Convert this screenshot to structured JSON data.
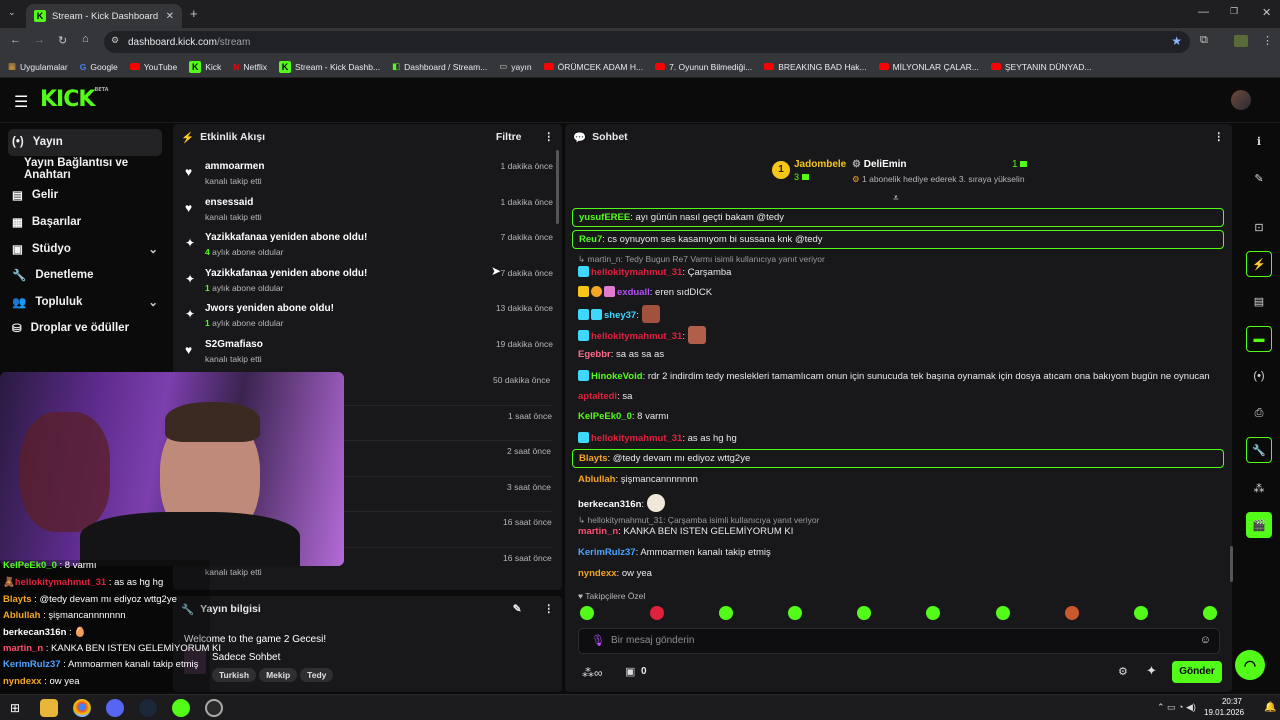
{
  "browser": {
    "tab_title": "Stream - Kick Dashboard",
    "url_host": "dashboard.kick.com",
    "url_path": "/stream",
    "bookmarks": [
      "Uygulamalar",
      "Google",
      "YouTube",
      "Kick",
      "Netflix",
      "Stream - Kick Dashb...",
      "Dashboard / Stream...",
      "yayın",
      "ÖRÜMCEK ADAM H...",
      "7. Oyunun Bilmediği...",
      "BREAKING BAD Hak...",
      "MİLYONLAR ÇALAR...",
      "ŞEYTANIN DÜNYAD..."
    ]
  },
  "site": {
    "logo": "KICK",
    "logo_beta": "BETA"
  },
  "sidebar": {
    "items": [
      {
        "label": "Yayın",
        "icon": "broadcast-icon"
      },
      {
        "label": "Yayın Bağlantısı ve Anahtarı",
        "icon": ""
      },
      {
        "label": "Gelir",
        "icon": "revenue-icon"
      },
      {
        "label": "Başarılar",
        "icon": "achievements-icon"
      },
      {
        "label": "Stüdyo",
        "icon": "studio-icon"
      },
      {
        "label": "Denetleme",
        "icon": "wrench-icon"
      },
      {
        "label": "Topluluk",
        "icon": "community-icon"
      },
      {
        "label": "Droplar ve ödüller",
        "icon": "drops-icon"
      }
    ]
  },
  "feed": {
    "title": "Etkinlik Akışı",
    "filter_label": "Filtre",
    "items": [
      {
        "title": "ammoarmen",
        "sub_count": "",
        "sub": "kanalı takip etti",
        "time": "1 dakika önce",
        "icon": "heart-icon"
      },
      {
        "title": "ensessaid",
        "sub_count": "",
        "sub": "kanalı takip etti",
        "time": "1 dakika önce",
        "icon": "heart-icon"
      },
      {
        "title": "Yazikkafanaa yeniden abone oldu!",
        "sub_count": "4",
        "sub": "aylık abone oldular",
        "time": "7 dakika önce",
        "icon": "sparkle-icon"
      },
      {
        "title": "Yazikkafanaa yeniden abone oldu!",
        "sub_count": "1",
        "sub": "aylık abone oldular",
        "time": "7 dakika önce",
        "icon": "sparkle-icon"
      },
      {
        "title": "Jwors yeniden abone oldu!",
        "sub_count": "1",
        "sub": "aylık abone oldular",
        "time": "13 dakika önce",
        "icon": "sparkle-icon"
      },
      {
        "title": "S2Gmafiaso",
        "sub_count": "",
        "sub": "kanalı takip etti",
        "time": "19 dakika önce",
        "icon": "heart-icon"
      }
    ],
    "more_times": [
      "50 dakika önce",
      "1 saat önce",
      "2 saat önce",
      "3 saat önce",
      "16 saat önce",
      "16 saat önce"
    ],
    "last_sub": "kanalı takip etti"
  },
  "stream_info": {
    "title": "Yayın bilgisi",
    "stream_title": "Welcome to the game 2 Gecesi!",
    "category": "Sadece Sohbet",
    "tags": [
      "Turkish",
      "Mekip",
      "Tedy"
    ]
  },
  "chat": {
    "title": "Sohbet",
    "top_gifter_rank": "1",
    "top_gifter_name": "Jadombele",
    "top_gifter_count": "3",
    "gift_user": "DeliEmin",
    "gift_count": "1",
    "gift_text": "1 abonelik hediye ederek 3. sıraya yükselin",
    "messages": [
      {
        "user": "yusufEREE",
        "text": "ayı günün nasıl geçti bakam @tedy",
        "color": "#53fc18"
      },
      {
        "user": "Reu7",
        "text": "cs oynuyom ses kasamıyom bi sussana knk @tedy",
        "color": "#53fc18"
      },
      {
        "reply": "martin_n: Tedy Bugun Re7 Varmı isimli kullanıcıya yanıt veriyor"
      },
      {
        "user": "hellokitymahmut_31",
        "text": "Çarşamba",
        "color": "#e0213c"
      },
      {
        "user": "exduall",
        "text": "eren sıdDICK",
        "color": "#b84dff"
      },
      {
        "user": "shey37",
        "text": "",
        "color": "#3dd7ff"
      },
      {
        "user": "hellokitymahmut_31",
        "text": "",
        "color": "#e0213c"
      },
      {
        "user": "Egebbr",
        "text": "sa as sa as",
        "color": "#ff6b8a"
      },
      {
        "user": "HinokeVoid",
        "text": "rdr 2 indirdim tedy meslekleri tamamlıcam onun için sunucuda tek başına oynamak için dosya atıcam ona bakıyom bugün ne oynucan",
        "color": "#53fc18"
      },
      {
        "user": "aptaltedi",
        "text": "sa",
        "color": "#e0213c"
      },
      {
        "user": "KelPeEk0_0",
        "text": "8 varmı",
        "color": "#53fc18"
      },
      {
        "user": "hellokitymahmut_31",
        "text": "as as hg hg",
        "color": "#e0213c"
      },
      {
        "user": "Blayts",
        "text": "@tedy devam mı ediyoz wttg2ye",
        "color": "#f5a623"
      },
      {
        "user": "Ablullah",
        "text": "şişmancannnnnnn",
        "color": "#f5a623"
      },
      {
        "user": "berkecan316n",
        "text": "",
        "color": "#ffffff"
      },
      {
        "reply": "hellokitymahmut_31: Çarşamba isimli kullanıcıya yanıt veriyor"
      },
      {
        "user": "martin_n",
        "text": "KANKA BEN ISTEN GELEMİYORUM KI",
        "color": "#ff4d6d"
      },
      {
        "user": "KerimRulz37",
        "text": "Ammoarmen kanalı takip etmiş",
        "color": "#4da3ff"
      },
      {
        "user": "nyndexx",
        "text": "ow yea",
        "color": "#f5a623"
      }
    ],
    "followers_only": "Takipçilere Özel",
    "input_placeholder": "Bir mesaj gönderin",
    "points": "0",
    "send_label": "Gönder"
  },
  "overlay": {
    "lines": [
      {
        "user": "KelPeEk0_0",
        "text": "8 varmı",
        "color": "#53fc18"
      },
      {
        "user": "hellokitymahmut_31",
        "text": "as as hg hg",
        "color": "#e0213c"
      },
      {
        "user": "Blayts",
        "text": "@tedy devam mı ediyoz wttg2ye",
        "color": "#f5a623"
      },
      {
        "user": "Ablullah",
        "text": "şişmancannnnnnn",
        "color": "#f5a623"
      },
      {
        "user": "berkecan316n",
        "text": "",
        "color": "#ffffff"
      },
      {
        "user": "martin_n",
        "text": "KANKA BEN ISTEN GELEMİYORUM KI",
        "color": "#ff4d6d"
      },
      {
        "user": "KerimRulz37",
        "text": "Ammoarmen kanalı takip etmiş",
        "color": "#4da3ff"
      },
      {
        "user": "nyndexx",
        "text": "ow yea",
        "color": "#f5a623"
      }
    ]
  },
  "taskbar": {
    "time": "20:37",
    "date": "19.01.2026"
  },
  "colors": {
    "accent": "#53fc18",
    "panel": "#18181b",
    "bg": "#0b0b0c"
  }
}
